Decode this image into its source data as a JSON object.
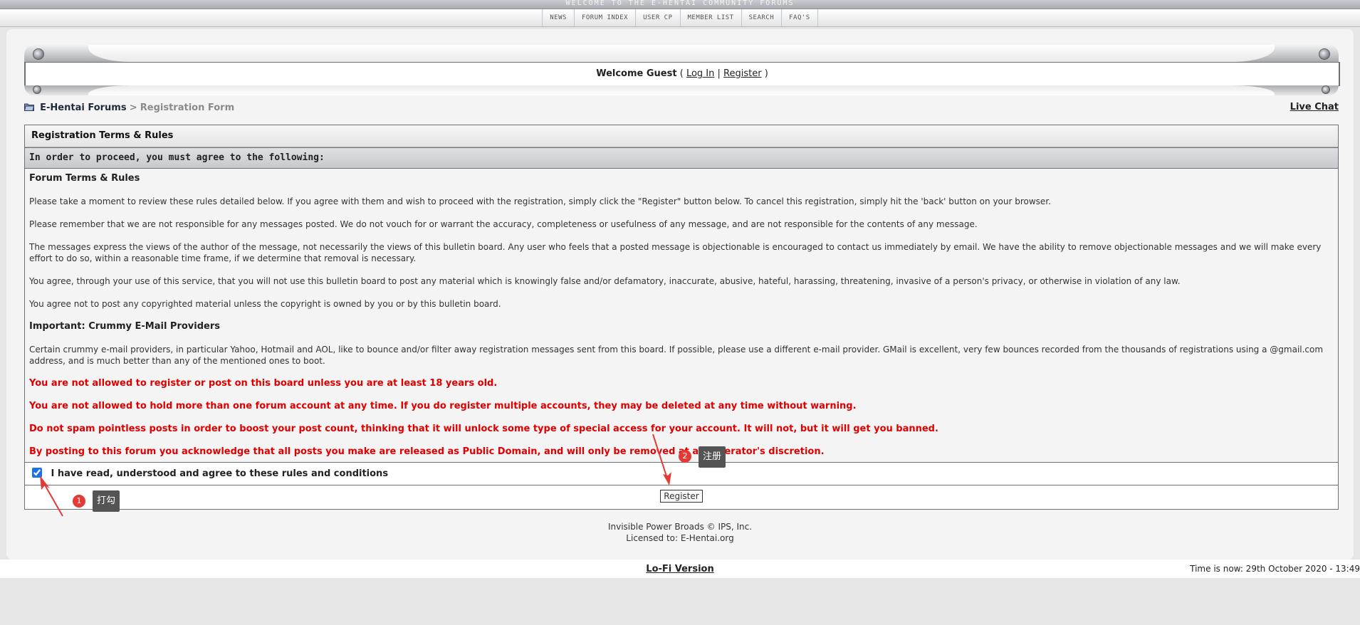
{
  "banner": {
    "text": "WELCOME TO THE E-HENTAI COMMUNITY FORUMS"
  },
  "nav": {
    "items": [
      "NEWS",
      "FORUM INDEX",
      "USER CP",
      "MEMBER LIST",
      "SEARCH",
      "FAQ'S"
    ]
  },
  "welcome": {
    "greeting": "Welcome Guest",
    "open": "(",
    "login": "Log In",
    "divider": "|",
    "register": "Register",
    "close": ")"
  },
  "breadcrumb": {
    "root": "E-Hentai Forums",
    "separator": ">",
    "current": "Registration Form"
  },
  "livechat": "Live Chat",
  "registration": {
    "title": "Registration Terms & Rules",
    "proceed": "In order to proceed, you must agree to the following:",
    "terms_heading": "Forum Terms & Rules",
    "para1": "Please take a moment to review these rules detailed below. If you agree with them and wish to proceed with the registration, simply click the \"Register\" button below. To cancel this registration, simply hit the 'back' button on your browser.",
    "para2": "Please remember that we are not responsible for any messages posted. We do not vouch for or warrant the accuracy, completeness or usefulness of any message, and are not responsible for the contents of any message.",
    "para3": "The messages express the views of the author of the message, not necessarily the views of this bulletin board. Any user who feels that a posted message is objectionable is encouraged to contact us immediately by email. We have the ability to remove objectionable messages and we will make every effort to do so, within a reasonable time frame, if we determine that removal is necessary.",
    "para4": "You agree, through your use of this service, that you will not use this bulletin board to post any material which is knowingly false and/or defamatory, inaccurate, abusive, hateful, harassing, threatening, invasive of a person's privacy, or otherwise in violation of any law.",
    "para5": "You agree not to post any copyrighted material unless the copyright is owned by you or by this bulletin board.",
    "important_heading": "Important: Crummy E-Mail Providers",
    "para6": "Certain crummy e-mail providers, in particular Yahoo, Hotmail and AOL, like to bounce and/or filter away registration messages sent from this board. If possible, please use a different e-mail provider. GMail is excellent, very few bounces recorded from the thousands of registrations using a @gmail.com address, and is much better than any of the mentioned ones to boot.",
    "red1": "You are not allowed to register or post on this board unless you are at least 18 years old.",
    "red2": "You are not allowed to hold more than one forum account at any time. If you do register multiple accounts, they may be deleted at any time without warning.",
    "red3": "Do not spam pointless posts in order to boost your post count, thinking that it will unlock some type of special access for your account. It will not, but it will get you banned.",
    "red4": "By posting to this forum you acknowledge that all posts you make are released as Public Domain, and will only be removed at a moderator's discretion.",
    "agree_label": "I have read, understood and agree to these rules and conditions",
    "agree_checked": true,
    "submit_label": "Register"
  },
  "footer": {
    "line1": "Invisible Power Broads © IPS, Inc.",
    "line2": "Licensed to: E-Hentai.org",
    "lofi": "Lo-Fi Version",
    "time": "Time is now: 29th October 2020 - 13:49"
  },
  "annotations": [
    {
      "number": "1",
      "label": "打勾"
    },
    {
      "number": "2",
      "label": "注册"
    }
  ],
  "colors": {
    "rule_red": "#e00000",
    "annotation_red": "#e53935",
    "annotation_box": "#545454"
  }
}
